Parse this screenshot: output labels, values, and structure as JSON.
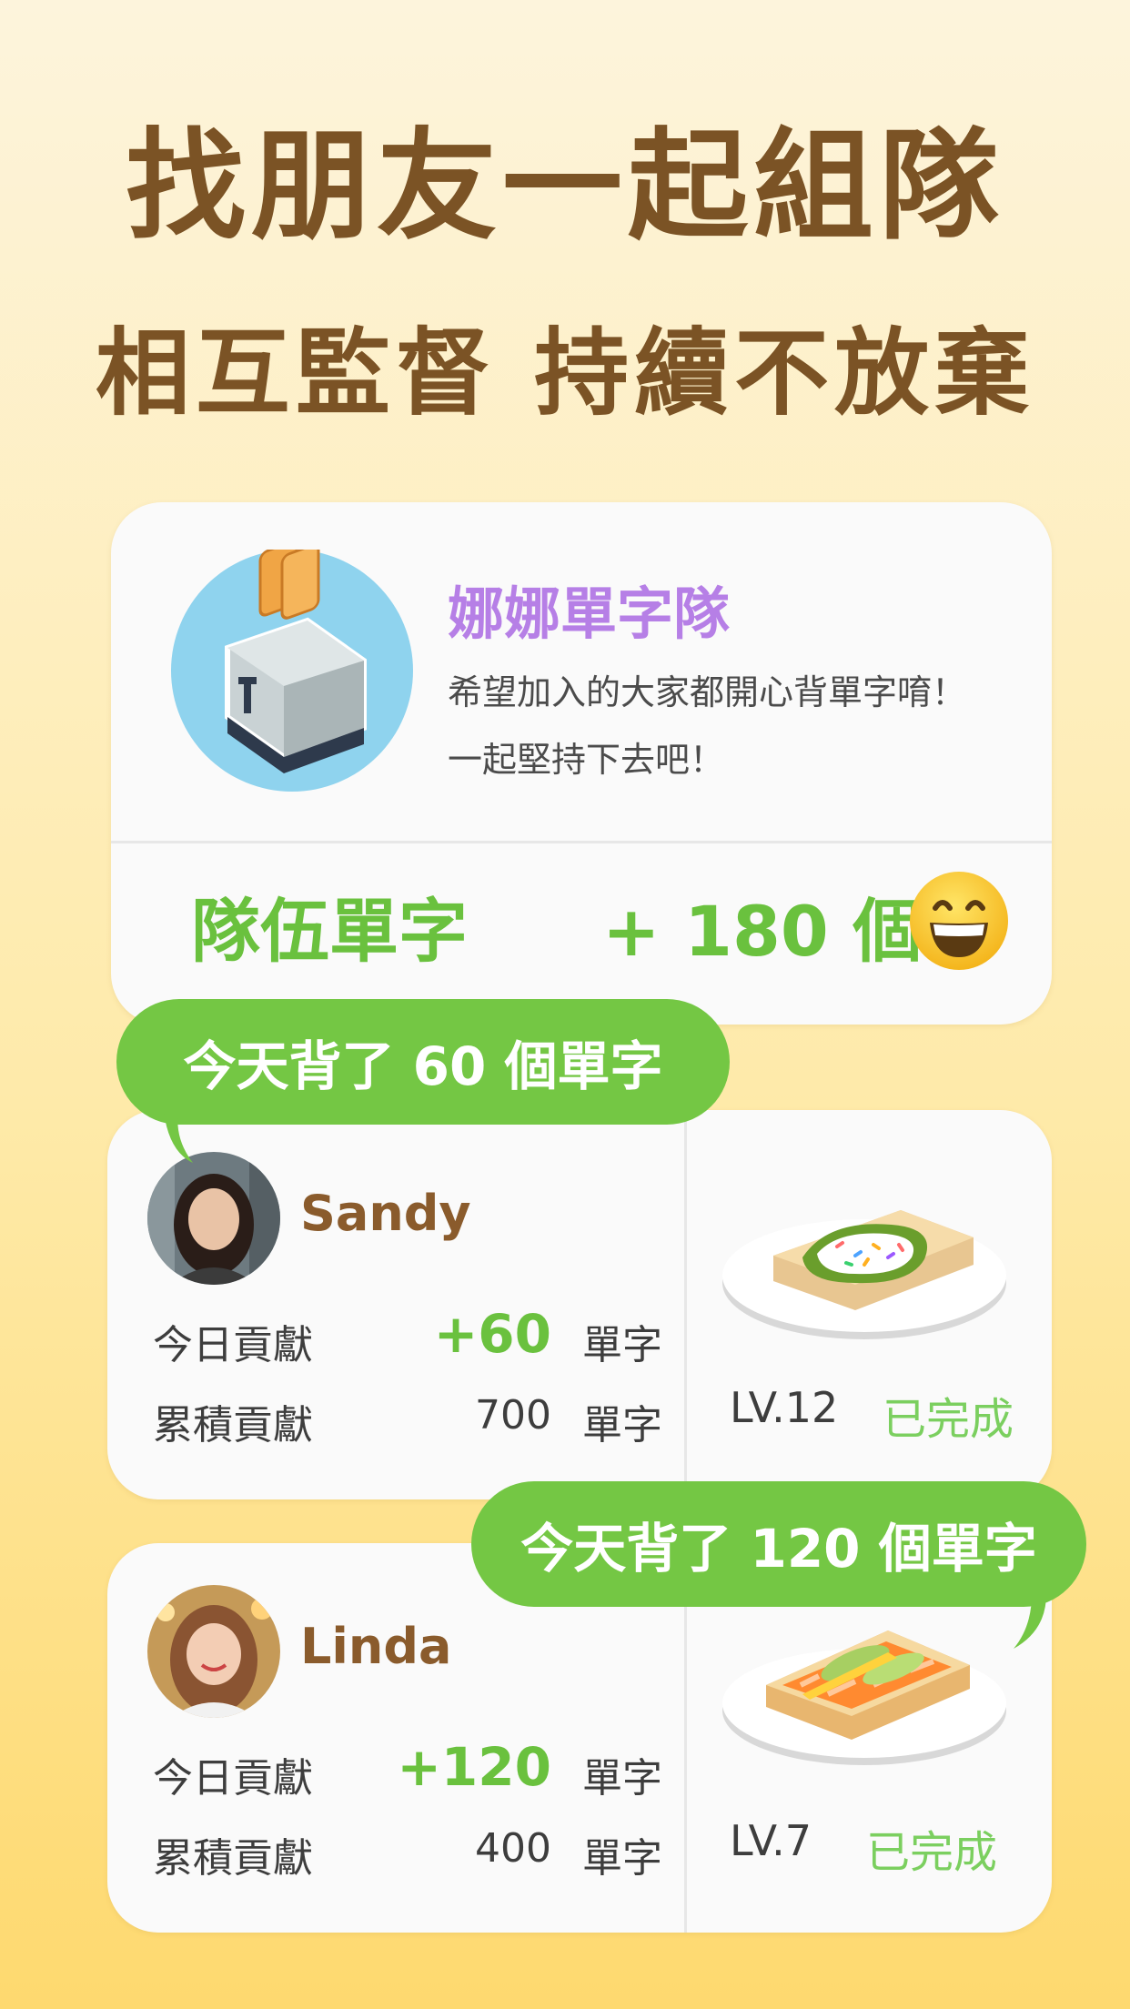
{
  "headline": {
    "line1": "找朋友一起組隊",
    "line2": "相互監督 持續不放棄"
  },
  "team": {
    "logo_icon": "toaster-icon",
    "name": "娜娜單字隊",
    "desc_line1": "希望加入的大家都開心背單字唷！",
    "desc_line2": "一起堅持下去吧！",
    "words_label": "隊伍單字",
    "words_value": "+ 180 個",
    "emoji": "grinning-face-icon"
  },
  "members": [
    {
      "bubble": "今天背了 60 個單字",
      "name": "Sandy",
      "today_label": "今日貢獻",
      "today_value": "+60",
      "today_unit": "單字",
      "total_label": "累積貢獻",
      "total_value": "700",
      "total_unit": "單字",
      "level": "LV.12",
      "status": "已完成",
      "food_icon": "avocado-toast-icon"
    },
    {
      "bubble": "今天背了 120 個單字",
      "name": "Linda",
      "today_label": "今日貢獻",
      "today_value": "+120",
      "today_unit": "單字",
      "total_label": "累積貢獻",
      "total_value": "400",
      "total_unit": "單字",
      "level": "LV.7",
      "status": "已完成",
      "food_icon": "salmon-avocado-toast-icon"
    }
  ],
  "colors": {
    "title": "#7b5325",
    "accent_green": "#6ac13e",
    "team_name": "#b67fe6",
    "bubble": "#74c744"
  }
}
